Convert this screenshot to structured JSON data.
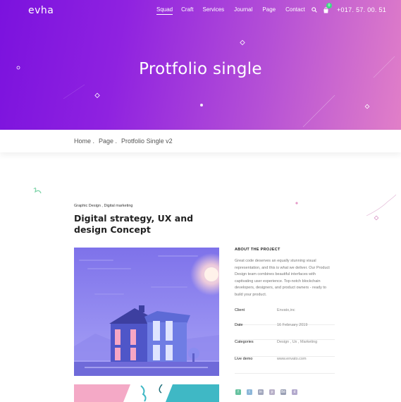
{
  "header": {
    "logo": "evha",
    "nav": [
      "Squad",
      "Craft",
      "Services",
      "Journal",
      "Page",
      "Contact"
    ],
    "cart_count": "0",
    "phone": "+017. 57. 00. 51"
  },
  "hero": {
    "title": "Protfolio single"
  },
  "breadcrumb": {
    "home": "Home .",
    "page": "Page .",
    "current": "Protfolio Single v2"
  },
  "project": {
    "category": "Graphic Design , Digital marketing",
    "title": "Digital strategy, UX and design Concept",
    "about_heading": "ABOUT THE PROJECT",
    "about_text": "Great code deserves an equally stunning visual representation, and this is what we deliver. Our Product Design team combines beautiful interfaces with captivating user experience. Top-notch blockchain developers, designers, and product owners - ready to build your product.",
    "meta": [
      {
        "key": "Client",
        "value": "Envato,inc"
      },
      {
        "key": "Date",
        "value": "16 February 2019"
      },
      {
        "key": "Categories",
        "value": "Design , Ux , Marketing"
      },
      {
        "key": "Live demo",
        "value": "www.envato.com"
      }
    ],
    "socials": [
      {
        "icon": "facebook-icon",
        "glyph": "f",
        "color": "#67c2a0"
      },
      {
        "icon": "twitter-icon",
        "glyph": "t",
        "color": "#8db7d9"
      },
      {
        "icon": "linkedin-icon",
        "glyph": "in",
        "color": "#a2a7bd"
      },
      {
        "icon": "pinterest-icon",
        "glyph": "p",
        "color": "#b8b0c8"
      },
      {
        "icon": "behance-icon",
        "glyph": "Bē",
        "color": "#9aa0b5"
      },
      {
        "icon": "dribbble-icon",
        "glyph": "d",
        "color": "#b3a9cd"
      }
    ]
  },
  "colors": {
    "hero_start": "#7b12de",
    "hero_end": "#e17fc8",
    "badge": "#3ddc84"
  }
}
